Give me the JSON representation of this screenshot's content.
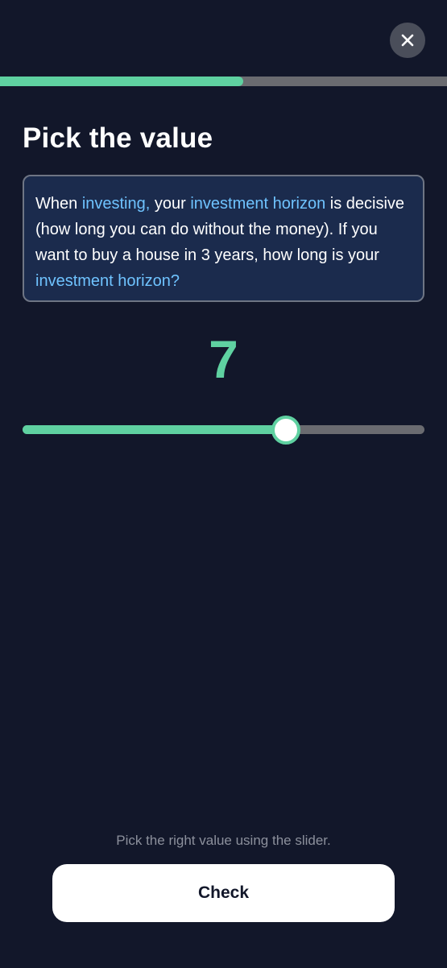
{
  "header": {
    "close_icon": "close-icon",
    "progress": 0.545
  },
  "title": "Pick the value",
  "question": {
    "segments": [
      {
        "text": "When ",
        "highlight": false
      },
      {
        "text": "investing,",
        "highlight": true
      },
      {
        "text": " your ",
        "highlight": false
      },
      {
        "text": "investment horizon",
        "highlight": true
      },
      {
        "text": " is decisive (how long you can do without the money). If you want to buy a house in 3 years, how long is your ",
        "highlight": false
      },
      {
        "text": "investment horizon?",
        "highlight": true
      }
    ]
  },
  "slider": {
    "value": "7",
    "position": 0.655
  },
  "hint": "Pick the right value using the slider.",
  "check_label": "Check",
  "colors": {
    "background": "#12172a",
    "accent": "#5fd1a1",
    "link": "#6fc3ff",
    "card": "#1b2b4d"
  }
}
